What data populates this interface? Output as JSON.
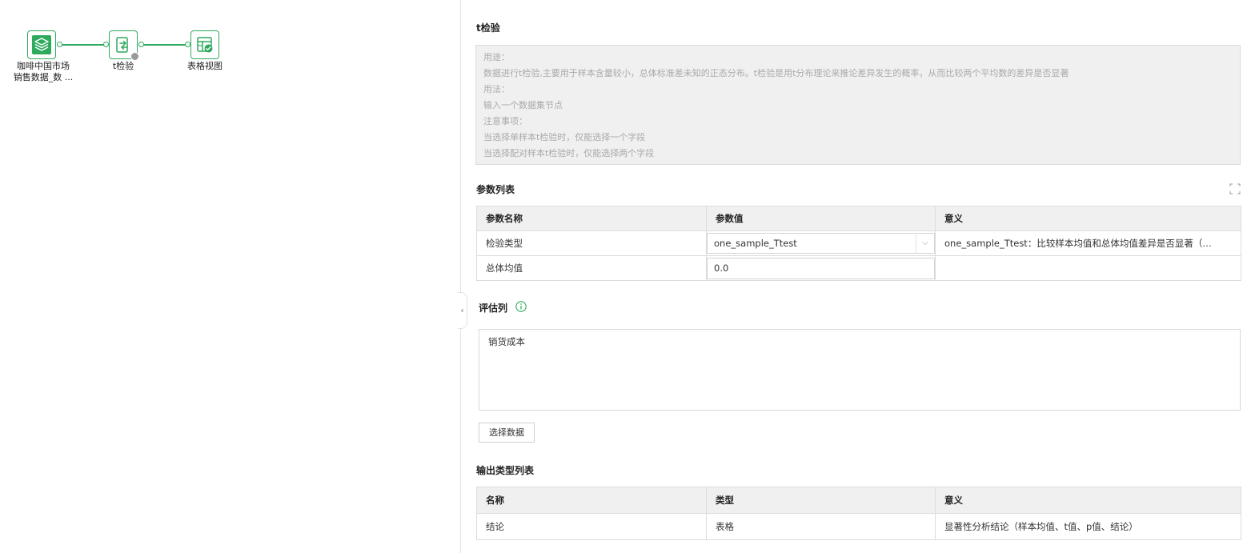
{
  "canvas": {
    "nodes": [
      {
        "label_line1": "咖啡中国市场",
        "label_line2": "销售数据_数 ...",
        "icon": "layers-icon"
      },
      {
        "label_line1": "t检验",
        "label_line2": "",
        "icon": "transform-icon"
      },
      {
        "label_line1": "表格视图",
        "label_line2": "",
        "icon": "table-view-icon"
      }
    ],
    "accent_color": "#2eaa5e"
  },
  "panel": {
    "title": "t检验",
    "description": [
      "用途：",
      "数据进行t检验,主要用于样本含量较小，总体标准差未知的正态分布。t检验是用t分布理论来推论差异发生的概率，从而比较两个平均数的差异是否显著",
      "用法：",
      "输入一个数据集节点",
      "注意事项：",
      "当选择单样本t检验时，仅能选择一个字段",
      "当选择配对样本t检验时，仅能选择两个字段"
    ],
    "params": {
      "title": "参数列表",
      "headers": [
        "参数名称",
        "参数值",
        "意义"
      ],
      "rows": [
        {
          "name": "检验类型",
          "value": "one_sample_Ttest",
          "meaning": "one_sample_Ttest：比较样本均值和总体均值差异是否显著（…"
        },
        {
          "name": "总体均值",
          "value": "0.0",
          "meaning": ""
        }
      ]
    },
    "eval": {
      "title": "评估列",
      "value": "销货成本",
      "select_button": "选择数据"
    },
    "output": {
      "title": "输出类型列表",
      "headers": [
        "名称",
        "类型",
        "意义"
      ],
      "rows": [
        {
          "name": "结论",
          "type": "表格",
          "meaning": "显著性分析结论（样本均值、t值、p值、结论）"
        }
      ]
    }
  }
}
